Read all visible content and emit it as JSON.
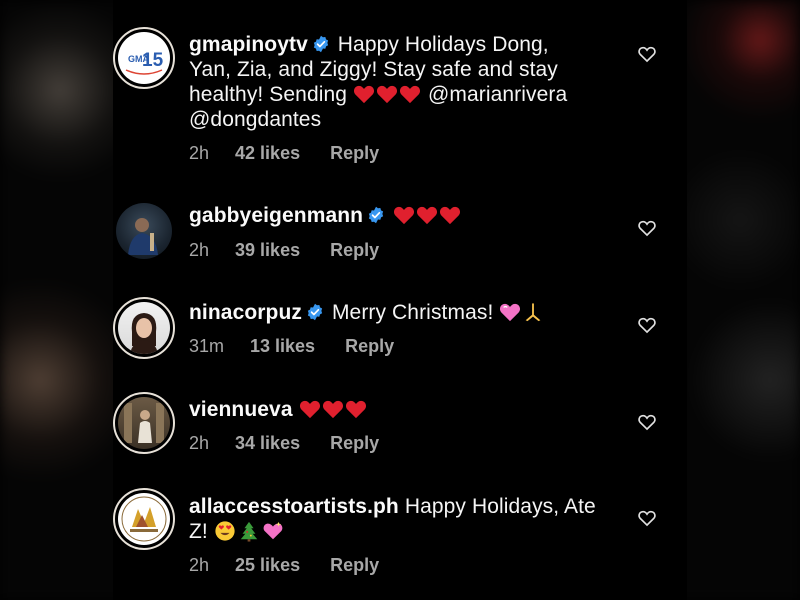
{
  "comments": [
    {
      "username": "gmapinoytv",
      "verified": true,
      "text_line1": "Happy Holidays Dong,",
      "text_line2": "Yan, Zia, and Ziggy! Stay safe and stay",
      "text_line3a": "healthy! Sending",
      "text_line3b": "@marianrivera",
      "text_line4": "@dongdantes",
      "time": "2h",
      "likes": "42 likes",
      "reply": "Reply",
      "avatar_badge": "15"
    },
    {
      "username": "gabbyeigenmann",
      "verified": true,
      "time": "2h",
      "likes": "39 likes",
      "reply": "Reply"
    },
    {
      "username": "ninacorpuz",
      "verified": true,
      "text": "Merry Christmas!",
      "time": "31m",
      "likes": "13 likes",
      "reply": "Reply"
    },
    {
      "username": "viennueva",
      "verified": false,
      "time": "2h",
      "likes": "34 likes",
      "reply": "Reply"
    },
    {
      "username": "allaccesstoartists.ph",
      "verified": false,
      "text_line1": "Happy Holidays, Ate",
      "text_line2": "Z!",
      "time": "2h",
      "likes": "25 likes",
      "reply": "Reply"
    }
  ],
  "colors": {
    "background": "#000000",
    "text": "#f5f5f5",
    "meta": "#a8a8a8",
    "verified": "#3897f0",
    "heart_emoji": "#e0202e"
  },
  "icons": [
    "verified-badge-icon",
    "like-heart-icon",
    "red-heart-emoji",
    "pink-heart-emoji",
    "praying-hands-emoji",
    "heart-eyes-emoji",
    "christmas-tree-emoji",
    "sparkling-heart-emoji"
  ]
}
